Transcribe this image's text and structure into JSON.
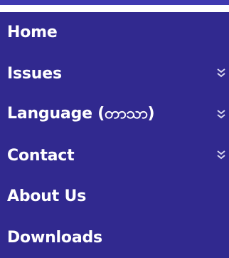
{
  "menu": {
    "items": [
      {
        "label": "Home",
        "has_submenu": false,
        "icon": ""
      },
      {
        "label": "Issues",
        "has_submenu": true,
        "icon": "double-chevron-down-icon"
      },
      {
        "label": "Language (တာသာ)",
        "has_submenu": true,
        "icon": "double-chevron-down-icon"
      },
      {
        "label": "Contact",
        "has_submenu": true,
        "icon": "double-chevron-down-icon"
      },
      {
        "label": "About Us",
        "has_submenu": false,
        "icon": ""
      },
      {
        "label": "Downloads",
        "has_submenu": false,
        "icon": ""
      }
    ]
  },
  "colors": {
    "menu_background": "#31298f",
    "top_rule": "#3f3ab0",
    "text": "#ffffff",
    "chevron": "#d8d8f0"
  }
}
